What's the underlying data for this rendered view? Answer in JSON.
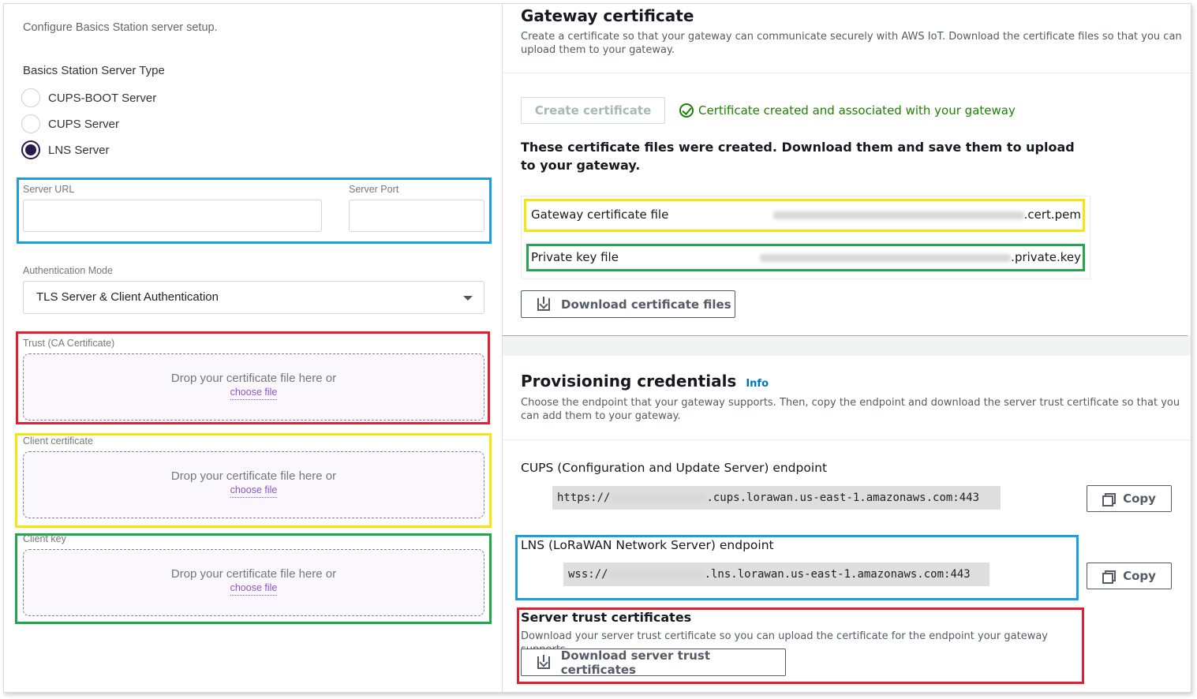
{
  "left": {
    "intro": "Configure Basics Station server setup.",
    "server_type_label": "Basics Station Server Type",
    "server_types": [
      {
        "label": "CUPS-BOOT Server",
        "selected": false
      },
      {
        "label": "CUPS Server",
        "selected": false
      },
      {
        "label": "LNS Server",
        "selected": true
      }
    ],
    "server_url_label": "Server URL",
    "server_url_value": "",
    "server_port_label": "Server Port",
    "server_port_value": "",
    "auth_mode_label": "Authentication Mode",
    "auth_mode_value": "TLS Server & Client Authentication",
    "uploads": [
      {
        "label": "Trust (CA Certificate)",
        "drop_text": "Drop your certificate file here or",
        "link": "choose file"
      },
      {
        "label": "Client certificate",
        "drop_text": "Drop your certificate file here or",
        "link": "choose file"
      },
      {
        "label": "Client key",
        "drop_text": "Drop your certificate file here or",
        "link": "choose file"
      }
    ]
  },
  "right": {
    "gateway_cert_title": "Gateway certificate",
    "gateway_cert_desc": "Create a certificate so that your gateway can communicate securely with AWS IoT. Download the certificate files so that you can upload them to your gateway.",
    "create_cert_button": "Create certificate",
    "success_message": "Certificate created and associated with your gateway",
    "files_created_text": "These certificate files were created. Download them and save them to upload to your gateway.",
    "files": [
      {
        "label": "Gateway certificate file",
        "suffix": ".cert.pem"
      },
      {
        "label": "Private key file",
        "suffix": ".private.key"
      }
    ],
    "download_cert_button": "Download certificate files",
    "prov_title": "Provisioning credentials",
    "info_link": "Info",
    "prov_desc": "Choose the endpoint that your gateway supports. Then, copy the endpoint and download the server trust certificate so that you can add them to your gateway.",
    "cups_label": "CUPS (Configuration and Update Server) endpoint",
    "cups_prefix": "https://",
    "cups_suffix": ".cups.lorawan.us-east-1.amazonaws.com:443",
    "lns_label": "LNS (LoRaWAN Network Server) endpoint",
    "lns_prefix": "wss://",
    "lns_suffix": ".lns.lorawan.us-east-1.amazonaws.com:443",
    "copy_label": "Copy",
    "trust_title": "Server trust certificates",
    "trust_desc": "Download your server trust certificate so you can upload the certificate for the endpoint your gateway supports.",
    "download_trust_button": "Download server trust certificates"
  },
  "colors": {
    "highlight_blue": "#1aa0e0",
    "highlight_red": "#e0202e",
    "highlight_yellow": "#f5e60f",
    "highlight_green": "#22a84a",
    "success_green": "#1d8102",
    "link_purple": "#8a55c8",
    "info_blue": "#0073bb"
  }
}
